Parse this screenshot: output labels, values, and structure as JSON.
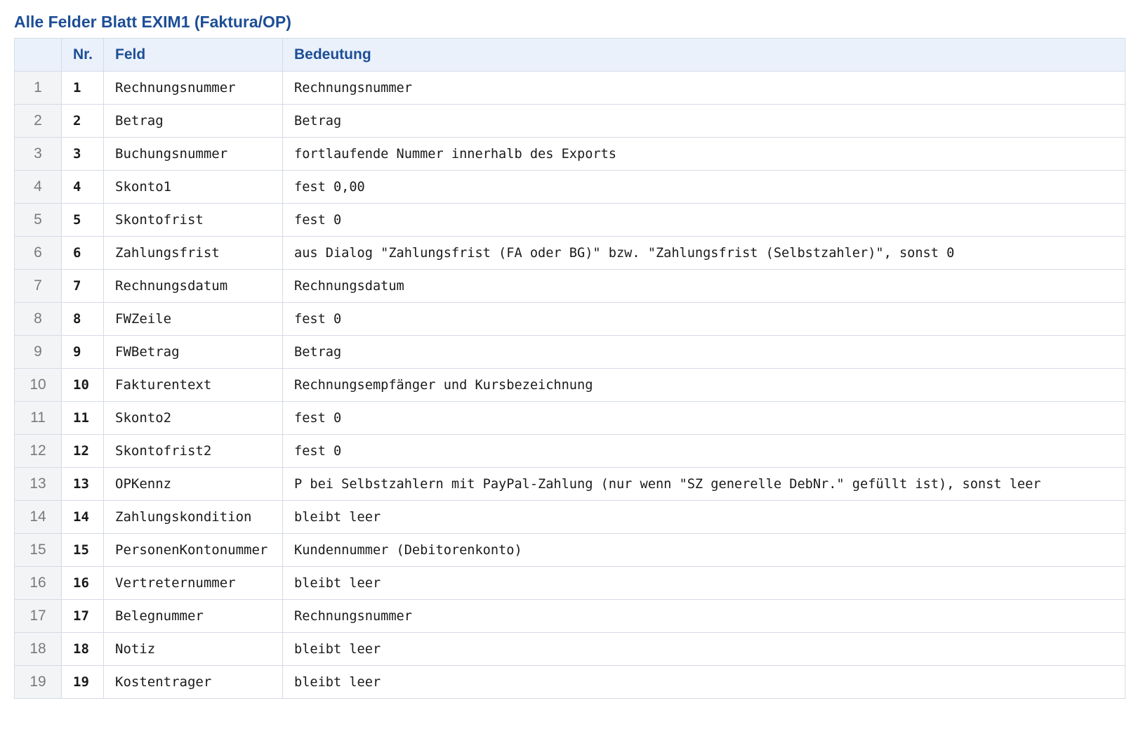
{
  "title": "Alle Felder Blatt EXIM1 (Faktura/OP)",
  "columns": {
    "index": "",
    "nr": "Nr.",
    "feld": "Feld",
    "bedeutung": "Bedeutung"
  },
  "rows": [
    {
      "idx": "1",
      "nr": "1",
      "feld": "Rechnungsnummer",
      "bedeutung": "Rechnungsnummer"
    },
    {
      "idx": "2",
      "nr": "2",
      "feld": "Betrag",
      "bedeutung": "Betrag"
    },
    {
      "idx": "3",
      "nr": "3",
      "feld": "Buchungsnummer",
      "bedeutung": "fortlaufende Nummer innerhalb des Exports"
    },
    {
      "idx": "4",
      "nr": "4",
      "feld": "Skonto1",
      "bedeutung": "fest 0,00"
    },
    {
      "idx": "5",
      "nr": "5",
      "feld": "Skontofrist",
      "bedeutung": "fest 0"
    },
    {
      "idx": "6",
      "nr": "6",
      "feld": "Zahlungsfrist",
      "bedeutung": "aus Dialog \"Zahlungsfrist (FA oder BG)\" bzw. \"Zahlungsfrist (Selbstzahler)\", sonst 0"
    },
    {
      "idx": "7",
      "nr": "7",
      "feld": "Rechnungsdatum",
      "bedeutung": "Rechnungsdatum"
    },
    {
      "idx": "8",
      "nr": "8",
      "feld": "FWZeile",
      "bedeutung": "fest 0"
    },
    {
      "idx": "9",
      "nr": "9",
      "feld": "FWBetrag",
      "bedeutung": "Betrag"
    },
    {
      "idx": "10",
      "nr": "10",
      "feld": "Fakturentext",
      "bedeutung": "Rechnungsempfänger und Kursbezeichnung"
    },
    {
      "idx": "11",
      "nr": "11",
      "feld": "Skonto2",
      "bedeutung": "fest 0"
    },
    {
      "idx": "12",
      "nr": "12",
      "feld": "Skontofrist2",
      "bedeutung": "fest 0"
    },
    {
      "idx": "13",
      "nr": "13",
      "feld": "OPKennz",
      "bedeutung": "P bei Selbstzahlern mit PayPal-Zahlung (nur wenn \"SZ generelle DebNr.\" gefüllt ist), sonst leer"
    },
    {
      "idx": "14",
      "nr": "14",
      "feld": "Zahlungskondition",
      "bedeutung": "bleibt leer"
    },
    {
      "idx": "15",
      "nr": "15",
      "feld": "PersonenKontonummer",
      "bedeutung": "Kundennummer (Debitorenkonto)"
    },
    {
      "idx": "16",
      "nr": "16",
      "feld": "Vertreternummer",
      "bedeutung": "bleibt leer"
    },
    {
      "idx": "17",
      "nr": "17",
      "feld": "Belegnummer",
      "bedeutung": "Rechnungsnummer"
    },
    {
      "idx": "18",
      "nr": "18",
      "feld": "Notiz",
      "bedeutung": "bleibt leer"
    },
    {
      "idx": "19",
      "nr": "19",
      "feld": "Kostentrager",
      "bedeutung": "bleibt leer"
    }
  ]
}
